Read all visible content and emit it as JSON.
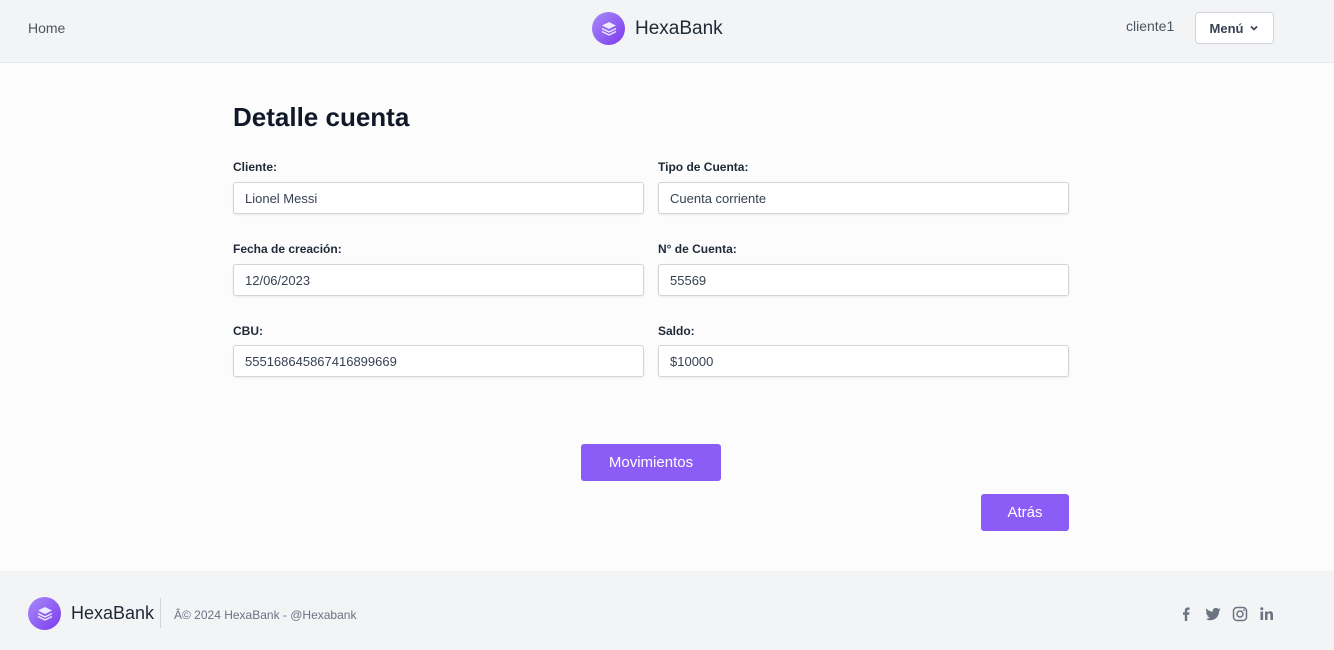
{
  "header": {
    "home_label": "Home",
    "brand_name": "HexaBank",
    "user_name": "cliente1",
    "menu_label": "Menú"
  },
  "main": {
    "title": "Detalle cuenta",
    "fields": {
      "cliente": {
        "label": "Cliente:",
        "value": "Lionel Messi"
      },
      "tipo_cuenta": {
        "label": "Tipo de Cuenta:",
        "value": "Cuenta corriente"
      },
      "fecha_creacion": {
        "label": "Fecha de creación:",
        "value": "12/06/2023"
      },
      "numero_cuenta": {
        "label": "N° de Cuenta:",
        "value": "55569"
      },
      "cbu": {
        "label": "CBU:",
        "value": "555168645867416899669"
      },
      "saldo": {
        "label": "Saldo:",
        "value": "$10000"
      }
    },
    "movimientos_label": "Movimientos",
    "atras_label": "Atrás"
  },
  "footer": {
    "brand_name": "HexaBank",
    "copyright": "Â© 2024 HexaBank  - @Hexabank",
    "social_icons": [
      "facebook-icon",
      "twitter-icon",
      "instagram-icon",
      "linkedin-icon"
    ]
  },
  "colors": {
    "accent": "#8b5cf6",
    "header_bg": "#f3f4f6",
    "page_bg": "#fcfcfc"
  }
}
